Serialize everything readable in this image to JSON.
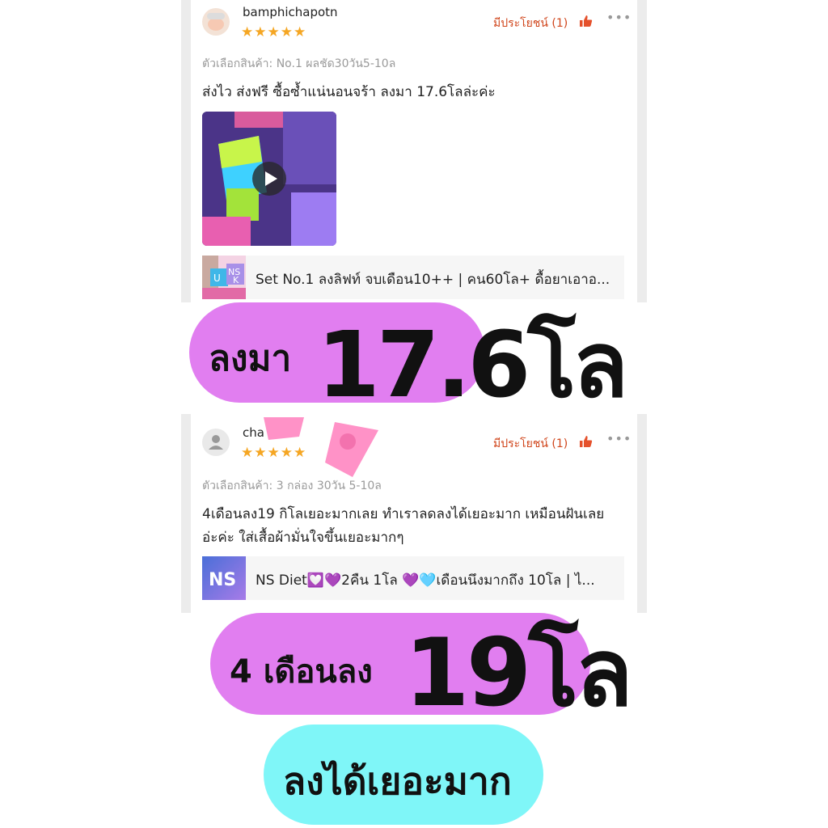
{
  "reviews": [
    {
      "username": "bamphichapotn",
      "stars": "★★★★★",
      "helpful": "มีประโยชน์ (1)",
      "variant": "ตัวเลือกสินค้า: No.1 ผลชัด30วัน5-10ล",
      "text": "ส่งไว ส่งฟรี ซื้อซ้ำแน่นอนจร้า ลงมา 17.6โลล่ะค่ะ",
      "product": "Set No.1 ลงลิฟท์ จบเดือน10++ | คน60โล+ ดื้อยาเอาอ..."
    },
    {
      "username": "cha",
      "stars": "★★★★★",
      "helpful": "มีประโยชน์ (1)",
      "variant": "ตัวเลือกสินค้า: 3 กล่อง 30วัน 5-10ล",
      "text_line1": "4เดือนลง19 กิโลเยอะมากเลย ทำเราลดลงได้เยอะมาก เหมือนฝันเลย",
      "text_line2": "อ่ะค่ะ ใส่เสื้อผ้ามั่นใจขึ้นเยอะมากๆ",
      "product": "NS Diet💟💜2คืน 1โล 💜🩵เดือนนึงมากถึง 10โล | ไ..."
    }
  ],
  "banners": {
    "b1_prefix": "ลงมา",
    "b1_big": "17.6โล",
    "b2_prefix": "4 เดือนลง",
    "b2_big": "19โล",
    "b3": "ลงได้เยอะมาก"
  },
  "thumb_labels": {
    "ns": "NS",
    "ns_small": "NS",
    "u": "U",
    "k": "K"
  },
  "colors": {
    "pink_pill": "#e17ef0",
    "cyan_pill": "#7ff6f8",
    "helpful": "#d0451b",
    "star": "#f5a623"
  }
}
